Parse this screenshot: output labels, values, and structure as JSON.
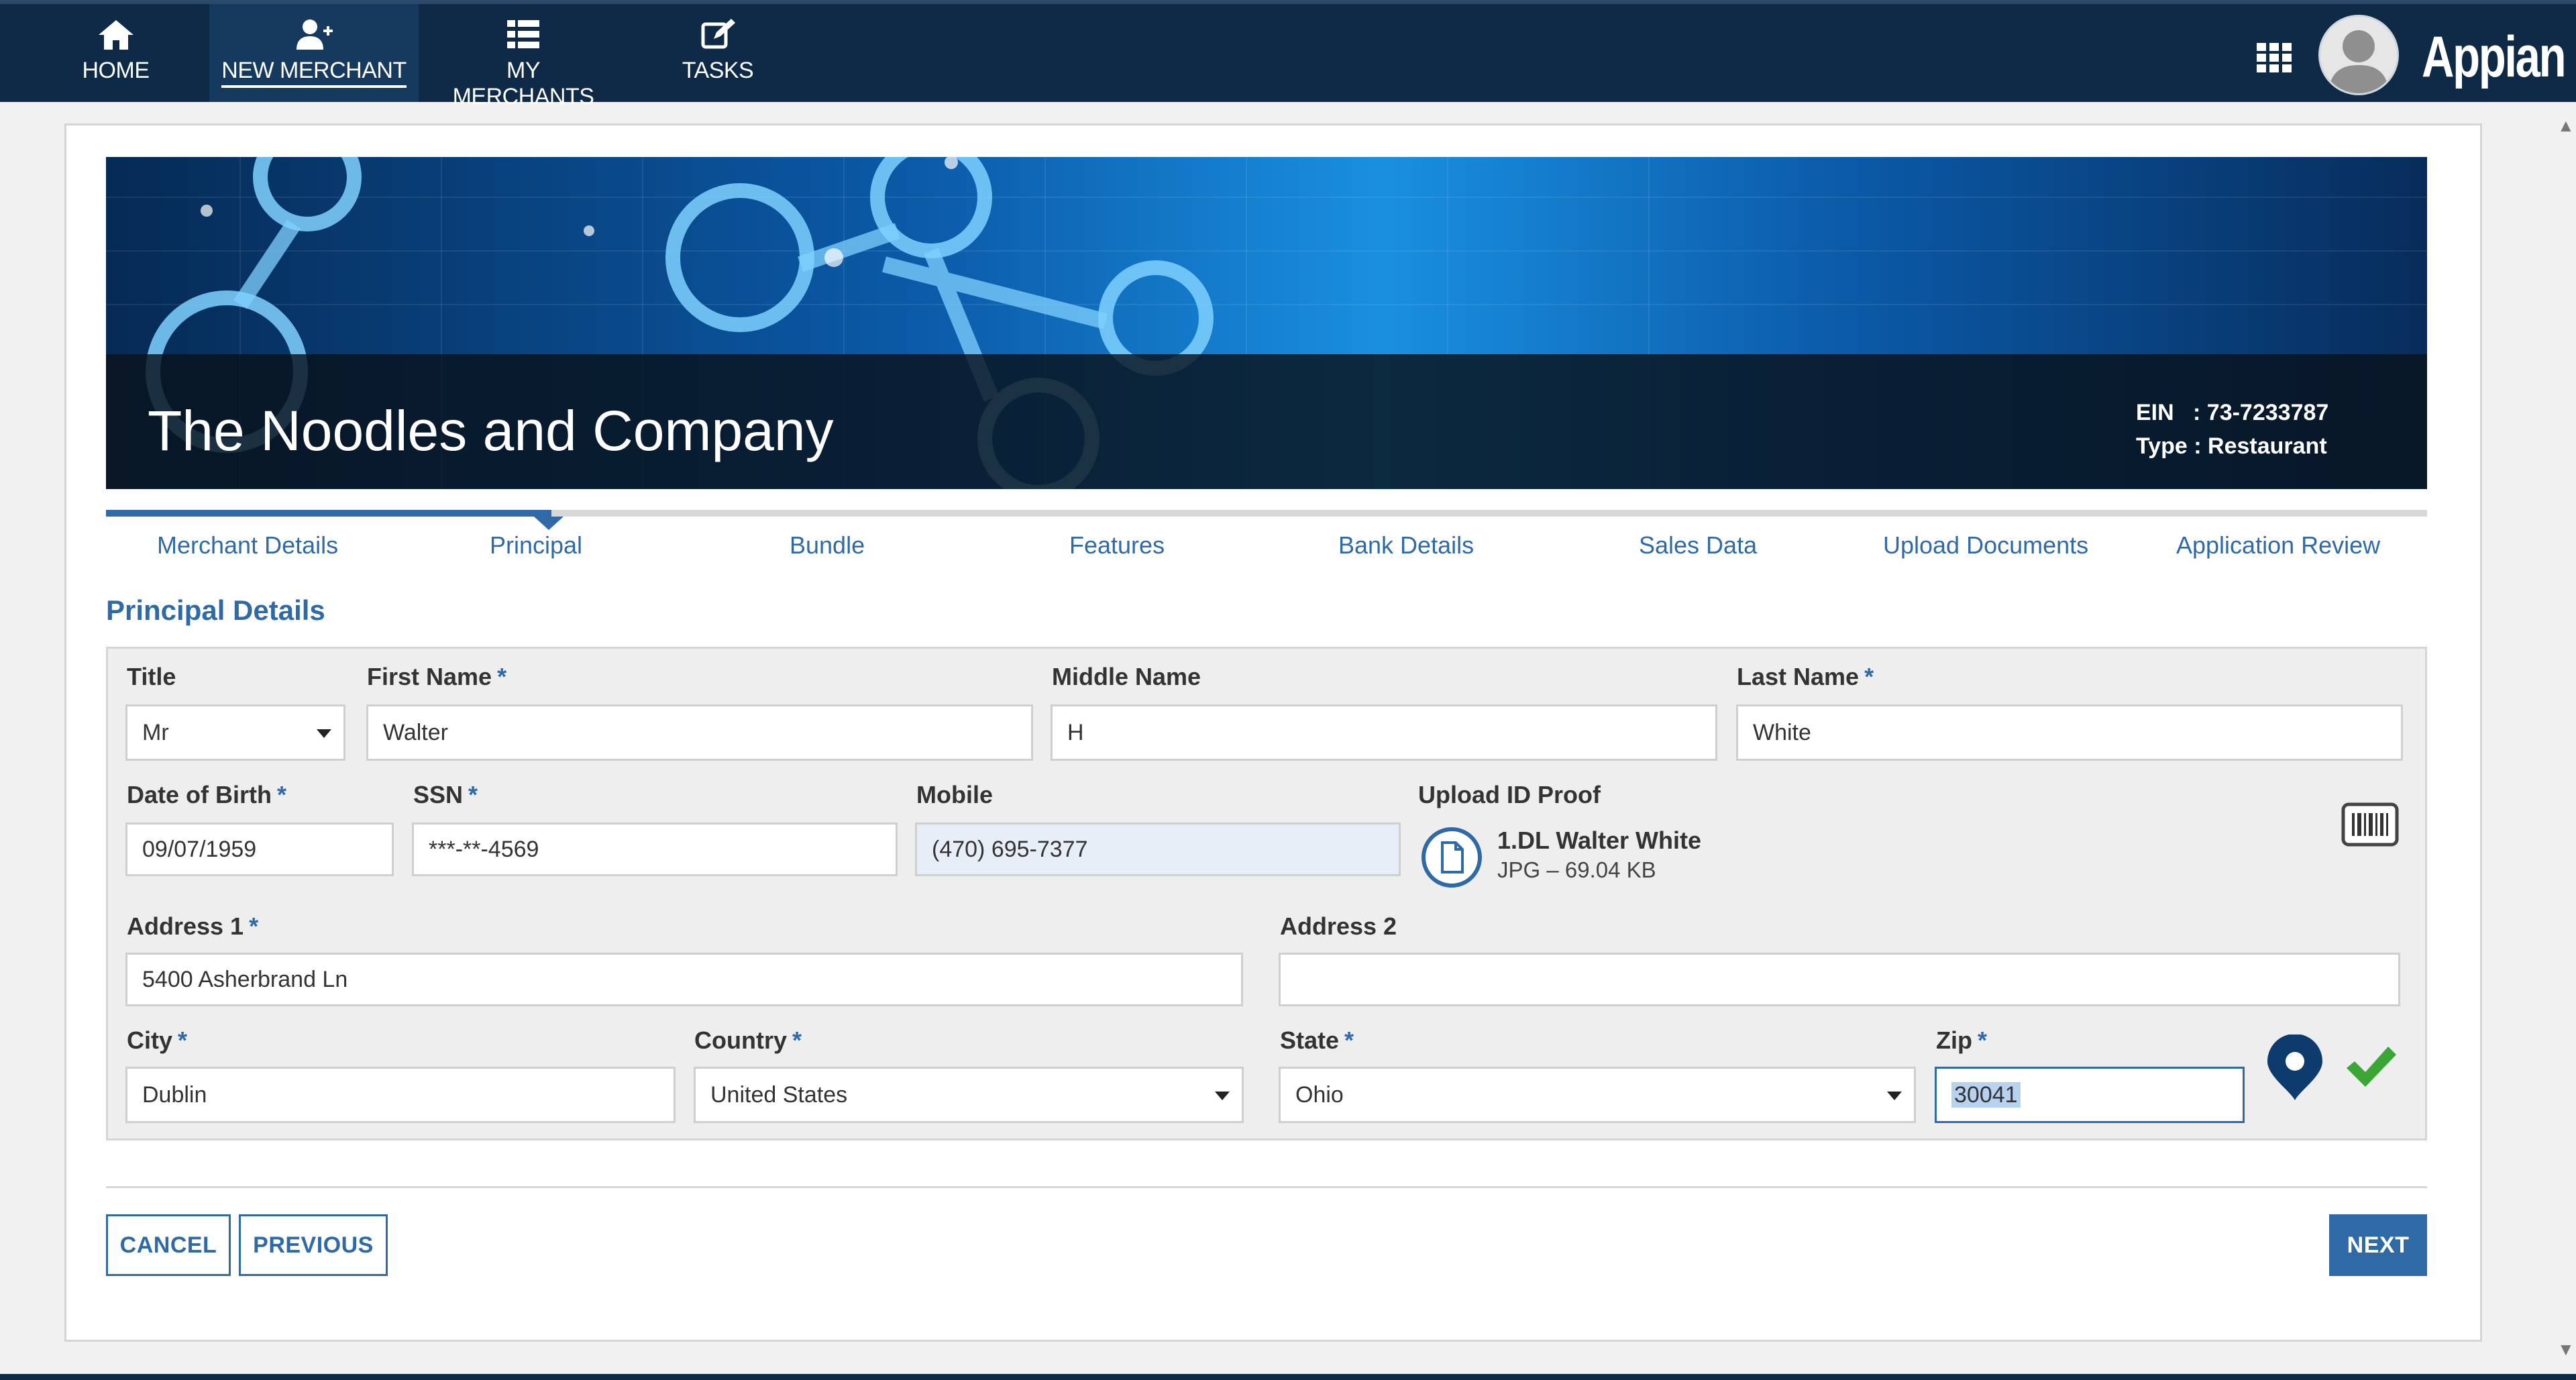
{
  "nav": {
    "items": [
      {
        "label": "HOME",
        "icon": "home-icon"
      },
      {
        "label": "NEW MERCHANT",
        "icon": "add-user-icon",
        "active": true
      },
      {
        "label": "MY MERCHANTS",
        "icon": "list-icon"
      },
      {
        "label": "TASKS",
        "icon": "edit-icon"
      }
    ],
    "brand": "Appian"
  },
  "banner": {
    "company": "The Noodles and Company",
    "ein": "EIN   : 73-7233787",
    "type": "Type : Restaurant"
  },
  "steps": [
    "Merchant Details",
    "Principal",
    "Bundle",
    "Features",
    "Bank Details",
    "Sales Data",
    "Upload Documents",
    "Application Review"
  ],
  "current_step": "Principal",
  "section_title": "Principal Details",
  "form": {
    "title": {
      "label": "Title",
      "value": "Mr"
    },
    "first_name": {
      "label": "First Name",
      "value": "Walter"
    },
    "middle_name": {
      "label": "Middle Name",
      "value": "H"
    },
    "last_name": {
      "label": "Last Name",
      "value": "White"
    },
    "dob": {
      "label": "Date of Birth",
      "value": "09/07/1959"
    },
    "ssn": {
      "label": "SSN",
      "value": "***-**-4569"
    },
    "mobile": {
      "label": "Mobile",
      "value": "(470) 695-7377"
    },
    "upload": {
      "label": "Upload ID Proof",
      "file_name": "1.DL Walter White",
      "file_meta": "JPG – 69.04 KB"
    },
    "address1": {
      "label": "Address 1",
      "value": "5400 Asherbrand Ln"
    },
    "address2": {
      "label": "Address 2",
      "value": ""
    },
    "city": {
      "label": "City",
      "value": "Dublin"
    },
    "country": {
      "label": "Country",
      "value": "United States"
    },
    "state": {
      "label": "State",
      "value": "Ohio"
    },
    "zip": {
      "label": "Zip",
      "value": "30041"
    },
    "required_marker": "*"
  },
  "buttons": {
    "cancel": "CANCEL",
    "previous": "PREVIOUS",
    "next": "NEXT"
  },
  "colors": {
    "nav_bg": "#0e2a47",
    "accent": "#2f6aa7",
    "check": "#3aa635"
  }
}
